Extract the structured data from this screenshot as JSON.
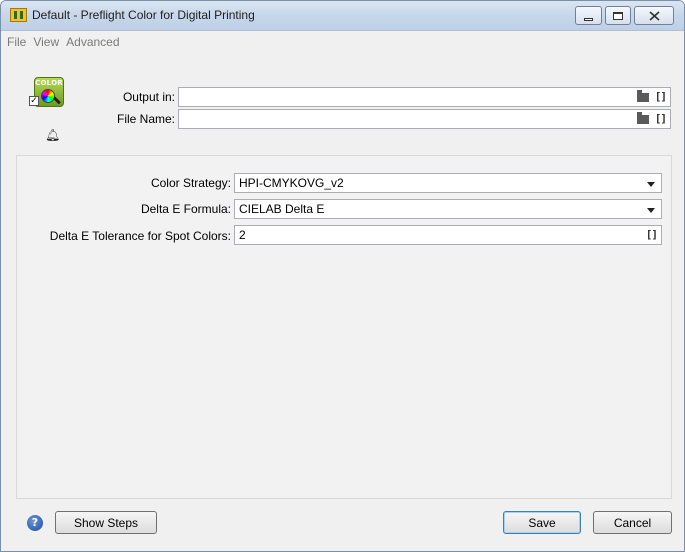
{
  "window": {
    "title": "Default - Preflight Color for Digital Printing"
  },
  "menu": {
    "items": [
      "File",
      "View",
      "Advanced"
    ]
  },
  "tool_icon": {
    "label": "COLOR",
    "checkbox_mark": "✓"
  },
  "output": {
    "output_in_label": "Output in:",
    "output_in_value": "",
    "file_name_label": "File Name:",
    "file_name_value": ""
  },
  "settings": {
    "color_strategy_label": "Color Strategy:",
    "color_strategy_value": "HPI-CMYKOVG_v2",
    "delta_formula_label": "Delta E Formula:",
    "delta_formula_value": "CIELAB Delta E",
    "tolerance_label": "Delta E Tolerance for Spot Colors:",
    "tolerance_value": "2"
  },
  "icons": {
    "variable": "[]",
    "help": "?"
  },
  "buttons": {
    "show_steps": "Show Steps",
    "save": "Save",
    "cancel": "Cancel"
  }
}
